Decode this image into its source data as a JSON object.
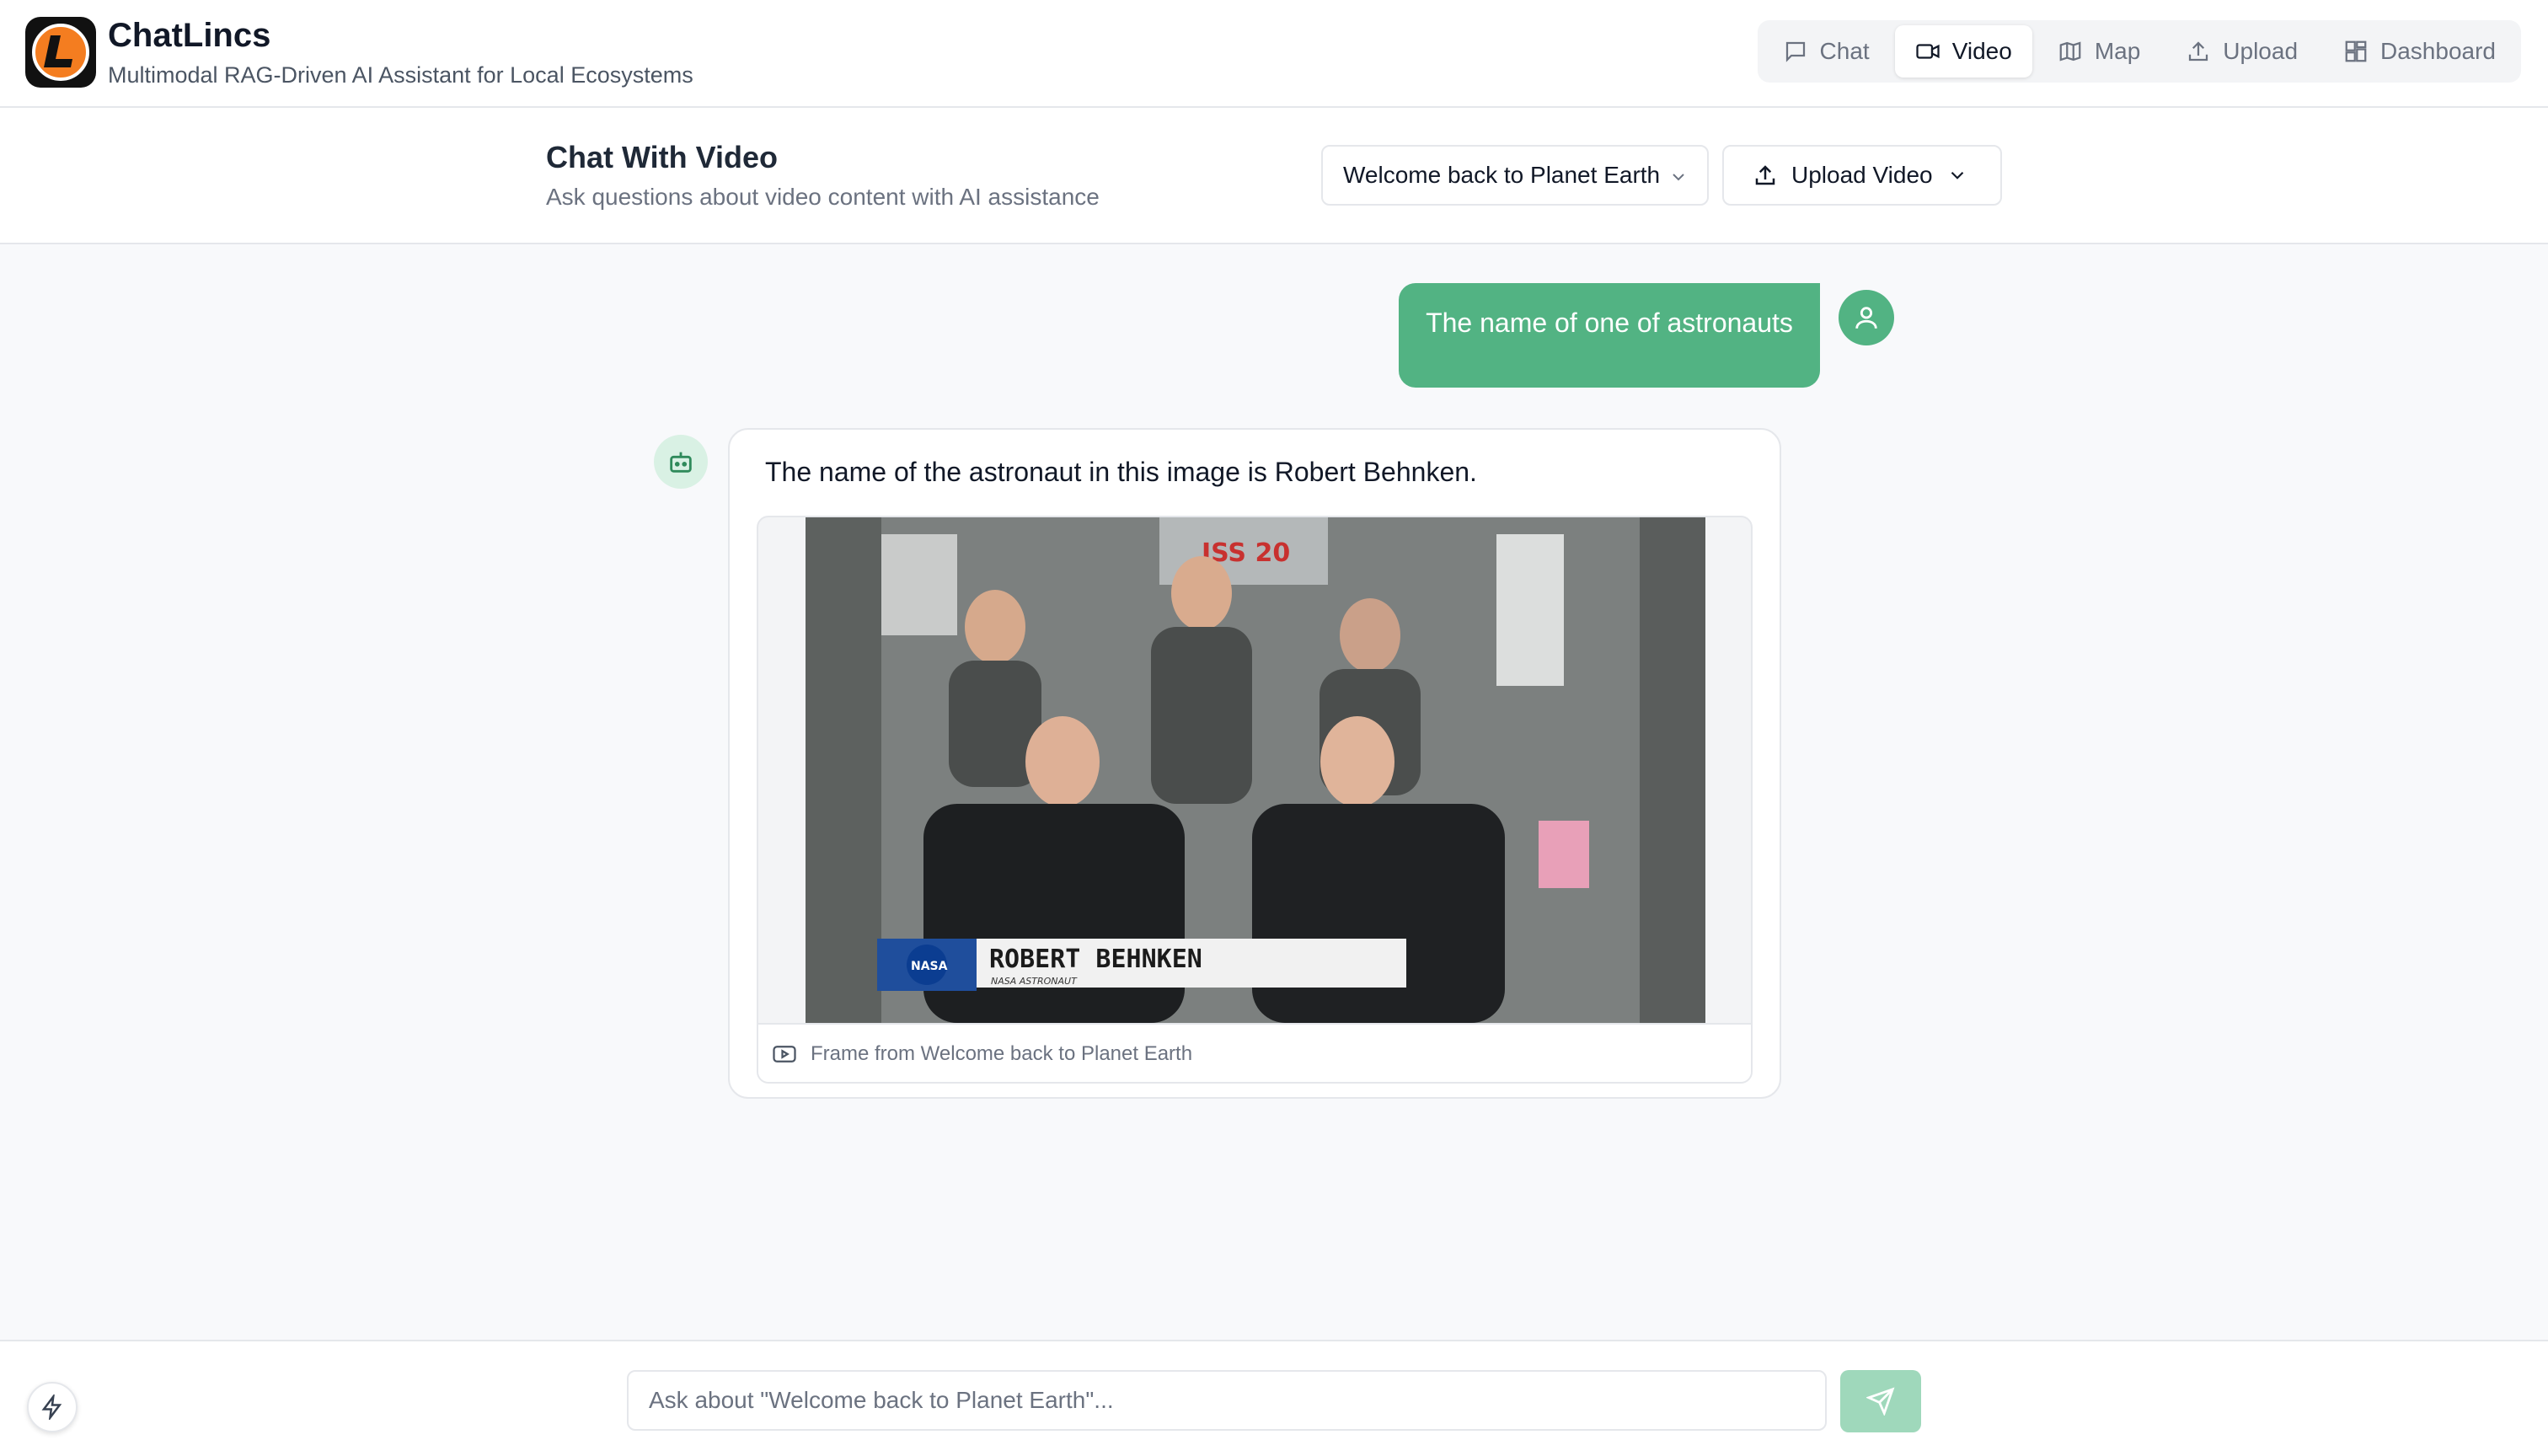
{
  "app": {
    "title": "ChatLincs",
    "subtitle": "Multimodal RAG-Driven AI Assistant for Local Ecosystems",
    "accent_color": "#52b383"
  },
  "nav": {
    "items": [
      {
        "label": "Chat",
        "icon": "chat-icon",
        "active": false
      },
      {
        "label": "Video",
        "icon": "video-icon",
        "active": true
      },
      {
        "label": "Map",
        "icon": "map-icon",
        "active": false
      },
      {
        "label": "Upload",
        "icon": "upload-icon",
        "active": false
      },
      {
        "label": "Dashboard",
        "icon": "dashboard-icon",
        "active": false
      }
    ]
  },
  "header": {
    "title": "Chat With Video",
    "subtitle": "Ask questions about video content with AI assistance",
    "selected_video": "Welcome back to Planet Earth",
    "upload_label": "Upload Video"
  },
  "messages": {
    "user_text": "The name of one of astronauts",
    "bot_text": "The name of the astronaut in this image is Robert Behnken.",
    "frame_caption": "Frame from Welcome back to Planet Earth",
    "frame_overlay": {
      "patch": "ISS 20",
      "name": "ROBERT BEHNKEN",
      "role": "NASA ASTRONAUT",
      "logo": "NASA"
    }
  },
  "composer": {
    "placeholder": "Ask about \"Welcome back to Planet Earth\"...",
    "value": ""
  }
}
